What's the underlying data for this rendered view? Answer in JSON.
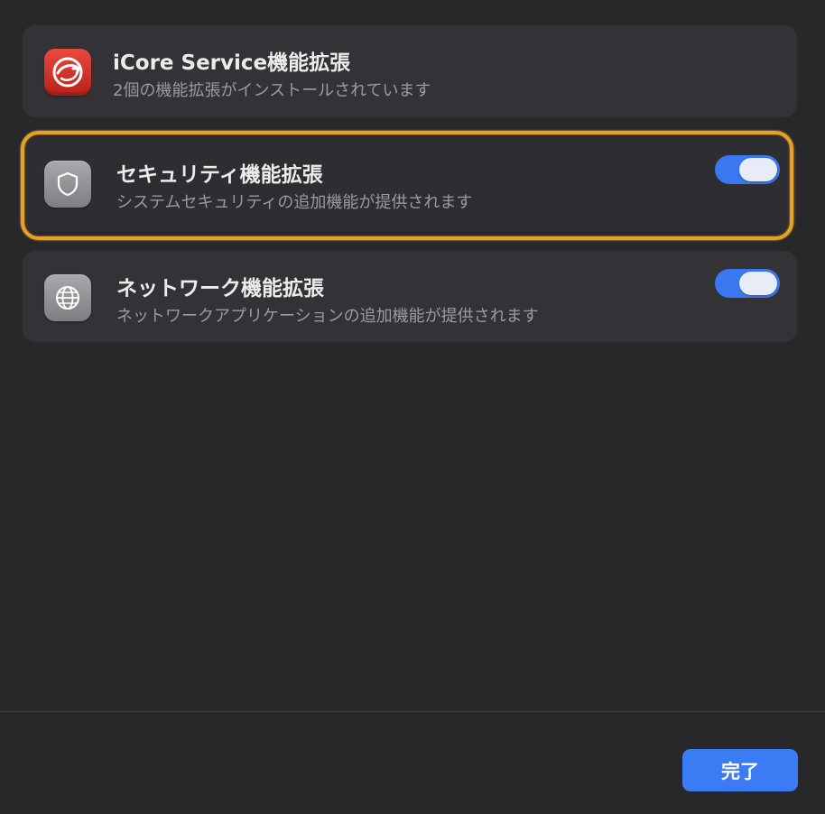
{
  "header": {
    "title": "iCore Service機能拡張",
    "subtitle": "2個の機能拡張がインストールされています",
    "icon": "trend-micro-logo-icon"
  },
  "extensions": [
    {
      "title": "セキュリティ機能拡張",
      "subtitle": "システムセキュリティの追加機能が提供されます",
      "icon": "shield-icon",
      "enabled": true
    },
    {
      "title": "ネットワーク機能拡張",
      "subtitle": "ネットワークアプリケーションの追加機能が提供されます",
      "icon": "globe-icon",
      "enabled": true
    }
  ],
  "footer": {
    "done_label": "完了"
  },
  "colors": {
    "accent": "#3b7cf4",
    "highlight": "#e6a126"
  }
}
